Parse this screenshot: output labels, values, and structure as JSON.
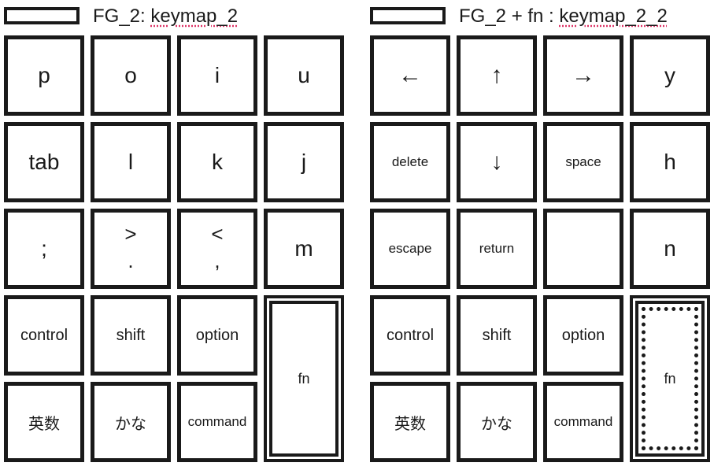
{
  "panels": [
    {
      "title_prefix": "FG_2: ",
      "title_word": "keymap_2",
      "rows": [
        [
          {
            "label": "p"
          },
          {
            "label": "o"
          },
          {
            "label": "i"
          },
          {
            "label": "u"
          }
        ],
        [
          {
            "label": "tab"
          },
          {
            "label": "l"
          },
          {
            "label": "k"
          },
          {
            "label": "j"
          }
        ],
        [
          {
            "label": ";"
          },
          {
            "top": ">",
            "bottom": "."
          },
          {
            "top": "<",
            "bottom": ","
          },
          {
            "label": "m"
          }
        ],
        [
          {
            "label": "control"
          },
          {
            "label": "shift"
          },
          {
            "label": "option"
          }
        ],
        [
          {
            "label": "英数"
          },
          {
            "label": "かな"
          },
          {
            "label": "command"
          }
        ]
      ],
      "fn": {
        "label": "fn",
        "active": false
      }
    },
    {
      "title_prefix": "FG_2 + fn : ",
      "title_word": "keymap_2_2",
      "rows": [
        [
          {
            "label": "←"
          },
          {
            "label": "↑"
          },
          {
            "label": "→"
          },
          {
            "label": "y"
          }
        ],
        [
          {
            "label": "delete"
          },
          {
            "label": "↓"
          },
          {
            "label": "space"
          },
          {
            "label": "h"
          }
        ],
        [
          {
            "label": "escape"
          },
          {
            "label": "return"
          },
          {
            "label": ""
          },
          {
            "label": "n"
          }
        ],
        [
          {
            "label": "control"
          },
          {
            "label": "shift"
          },
          {
            "label": "option"
          }
        ],
        [
          {
            "label": "英数"
          },
          {
            "label": "かな"
          },
          {
            "label": "command"
          }
        ]
      ],
      "fn": {
        "label": "fn",
        "active": true
      }
    }
  ]
}
